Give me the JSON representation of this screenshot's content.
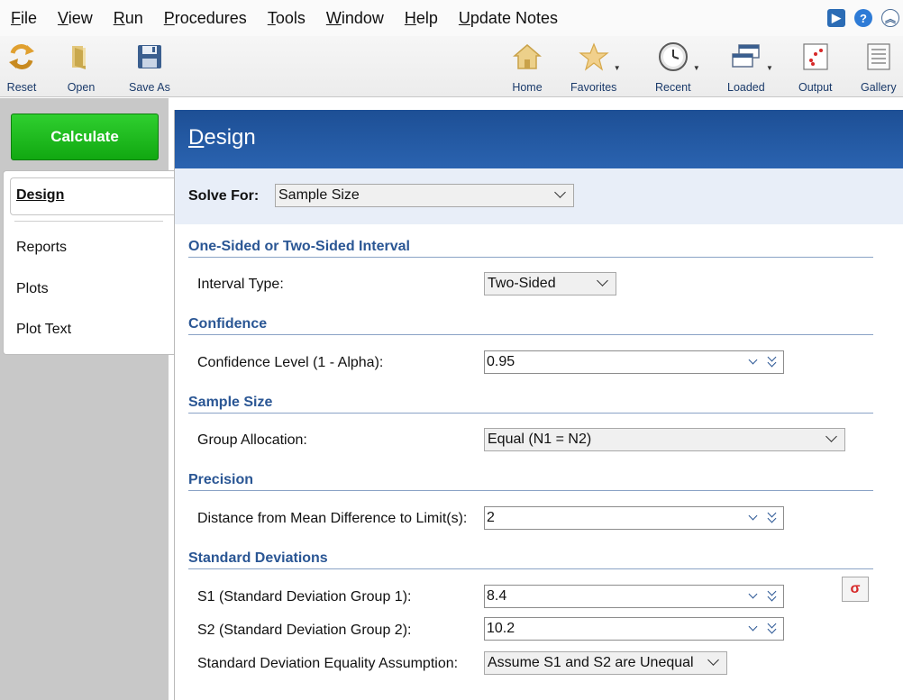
{
  "menubar": {
    "items": [
      "File",
      "View",
      "Run",
      "Procedures",
      "Tools",
      "Window",
      "Help",
      "Update Notes"
    ],
    "right_icons": [
      "play-icon",
      "help-icon",
      "collapse-icon"
    ]
  },
  "toolbar": {
    "reset": "Reset",
    "open": "Open",
    "save_as": "Save As",
    "home": "Home",
    "favorites": "Favorites",
    "recent": "Recent",
    "loaded": "Loaded",
    "output": "Output",
    "gallery": "Gallery"
  },
  "left": {
    "calculate": "Calculate",
    "nav": [
      "Design",
      "Reports",
      "Plots",
      "Plot Text"
    ]
  },
  "main": {
    "title": "Design",
    "solve_for": {
      "label": "Solve For:",
      "value": "Sample Size"
    },
    "sections": {
      "interval": "One-Sided or Two-Sided Interval",
      "confidence": "Confidence",
      "sample_size": "Sample Size",
      "precision": "Precision",
      "std_dev": "Standard Deviations"
    },
    "fields": {
      "interval_type": {
        "label": "Interval Type:",
        "value": "Two-Sided"
      },
      "confidence_level": {
        "label": "Confidence Level (1 - Alpha):",
        "value": "0.95"
      },
      "group_allocation": {
        "label": "Group Allocation:",
        "value": "Equal (N1 = N2)"
      },
      "distance": {
        "label": "Distance from Mean Difference to Limit(s):",
        "value": "2"
      },
      "s1": {
        "label": "S1 (Standard Deviation Group 1):",
        "value": "8.4"
      },
      "s2": {
        "label": "S2 (Standard Deviation Group 2):",
        "value": "10.2"
      },
      "equality": {
        "label": "Standard Deviation Equality Assumption:",
        "value": "Assume S1 and S2 are Unequal"
      }
    },
    "sigma_glyph": "σ"
  },
  "colors": {
    "header_blue": "#1d4f95",
    "section_blue": "#2a5694",
    "calculate_green": "#1cb81c"
  }
}
